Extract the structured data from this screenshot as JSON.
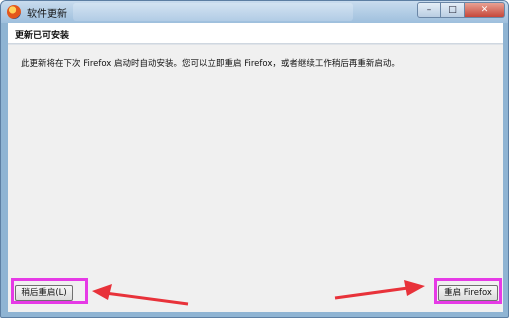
{
  "window": {
    "title": "软件更新"
  },
  "header": {
    "title": "更新已可安装"
  },
  "content": {
    "message": "此更新将在下次 Firefox 启动时自动安装。您可以立即重启 Firefox，或者继续工作稍后再重新启动。"
  },
  "buttons": {
    "later_label": "稍后重启(L)",
    "restart_label": "重启 Firefox"
  },
  "controls": {
    "minimize": "–",
    "maximize": "□",
    "close": "✕"
  },
  "colors": {
    "highlight": "#e63ae6",
    "arrow": "#e8323a"
  }
}
